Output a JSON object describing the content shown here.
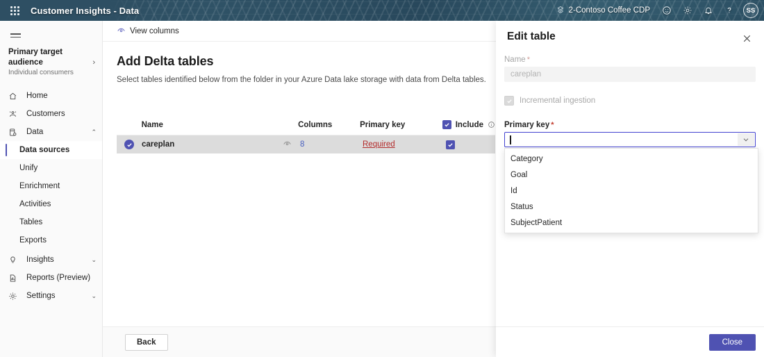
{
  "banner": {
    "app_title": "Customer Insights - Data",
    "waffle_icon": "app-launcher-icon",
    "environment": "2-Contoso Coffee CDP",
    "environment_icon": "environment-icon",
    "icons": [
      {
        "name": "feedback-smiley-icon",
        "glyph": "smiley"
      },
      {
        "name": "settings-gear-icon",
        "glyph": "gear"
      },
      {
        "name": "notifications-bell-icon",
        "glyph": "bell"
      },
      {
        "name": "help-question-icon",
        "glyph": "question"
      }
    ],
    "avatar_initials": "SS"
  },
  "sidebar": {
    "hamburger_icon": "hamburger-menu-icon",
    "audience": {
      "title": "Primary target audience",
      "subtitle": "Individual consumers",
      "chevron": "›"
    },
    "items": [
      {
        "label": "Home",
        "icon": "home-icon",
        "type": "top",
        "chevron": ""
      },
      {
        "label": "Customers",
        "icon": "customers-icon",
        "type": "top",
        "chevron": ""
      },
      {
        "label": "Data",
        "icon": "data-icon",
        "type": "top",
        "chevron": "⌃",
        "expanded": true
      },
      {
        "label": "Data sources",
        "icon": "",
        "type": "sub",
        "selected": true
      },
      {
        "label": "Unify",
        "icon": "",
        "type": "sub"
      },
      {
        "label": "Enrichment",
        "icon": "",
        "type": "sub"
      },
      {
        "label": "Activities",
        "icon": "",
        "type": "sub"
      },
      {
        "label": "Tables",
        "icon": "",
        "type": "sub"
      },
      {
        "label": "Exports",
        "icon": "",
        "type": "sub"
      },
      {
        "label": "Insights",
        "icon": "insights-bulb-icon",
        "type": "top",
        "chevron": "⌄"
      },
      {
        "label": "Reports (Preview)",
        "icon": "reports-icon",
        "type": "top",
        "chevron": ""
      },
      {
        "label": "Settings",
        "icon": "settings-gear-icon",
        "type": "top",
        "chevron": "⌄"
      }
    ]
  },
  "commandbar": {
    "view_columns_label": "View columns",
    "view_columns_icon": "eye-icon"
  },
  "page": {
    "title": "Add Delta tables",
    "subtitle": "Select tables identified below from the folder in your Azure Data lake storage with data from Delta tables."
  },
  "table": {
    "columns": {
      "name": "Name",
      "columns": "Columns",
      "primary_key": "Primary key",
      "include": "Include"
    },
    "include_header_checked": true,
    "include_info_icon": "info-icon",
    "rows": [
      {
        "selected": true,
        "name": "careplan",
        "preview_icon": "eye-icon",
        "columns": "8",
        "primary_key": "Required",
        "primary_key_state": "required",
        "include": true
      }
    ]
  },
  "footer": {
    "back_label": "Back"
  },
  "panel": {
    "title": "Edit table",
    "close_icon": "close-icon",
    "name_field": {
      "label": "Name",
      "required_marker": "*",
      "value": "careplan",
      "disabled": true
    },
    "incremental_ingestion": {
      "label": "Incremental ingestion",
      "checked": true,
      "disabled": true
    },
    "primary_key_field": {
      "label": "Primary key",
      "required_marker": "*",
      "value": "",
      "expanded": true,
      "chevron_icon": "chevron-down-icon",
      "options": [
        "Category",
        "Goal",
        "Id",
        "Status",
        "SubjectPatient"
      ]
    },
    "close_button": "Close"
  },
  "colors": {
    "accent": "#4f52b2",
    "focus_border": "#4242d0",
    "link": "#4a61c0",
    "error": "#b32a2a",
    "banner_base": "#2e4f63"
  }
}
